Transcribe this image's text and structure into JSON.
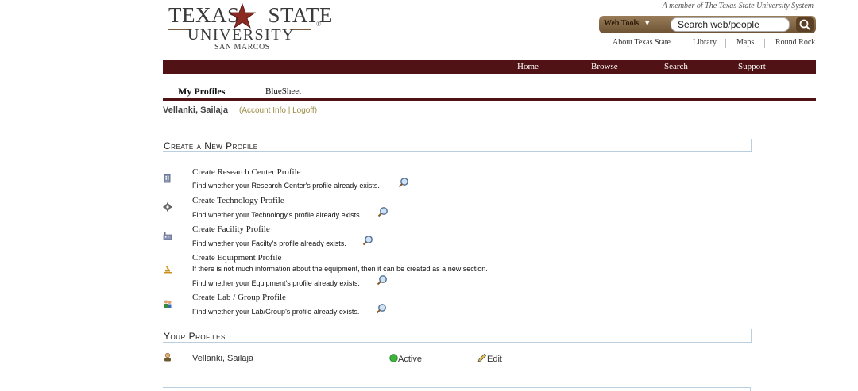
{
  "logo": {
    "line1_a": "TEXAS",
    "line1_b": "STATE",
    "line2": "UNIVERSITY",
    "line3": "SAN MARCOS",
    "reg": "®"
  },
  "member_text": "A member of The Texas State University System",
  "search": {
    "webtools_label": "Web Tools",
    "caret": "▼",
    "placeholder": "Search web/people",
    "value": "Search web/people"
  },
  "toplinks": [
    "About Texas State",
    "Library",
    "Maps",
    "Round Rock"
  ],
  "nav": [
    "Home",
    "Browse",
    "Search",
    "Support"
  ],
  "tabs": {
    "active": "My Profiles",
    "other": "BlueSheet"
  },
  "user": {
    "name": "Vellanki, Sailaja",
    "links": "(Account Info | Logoff)"
  },
  "create_section": {
    "title": "Create a New Profile",
    "items": [
      {
        "title": "Create Research Center Profile",
        "sub": "Find whether your Research Center's profile already exists.",
        "icon": "building-icon"
      },
      {
        "title": "Create Technology Profile",
        "sub": "Find whether your Technology's profile already exists.",
        "icon": "gear-icon"
      },
      {
        "title": "Create Facility Profile",
        "sub": "Find whether your Facilty's profile already exists.",
        "icon": "factory-icon"
      },
      {
        "title": "Create Equipment Profile",
        "note": "If there is not much information about the equipment, then it can be created as a new section.",
        "sub": "Find whether your Equipment's profile already exists.",
        "icon": "microscope-icon"
      },
      {
        "title": "Create Lab / Group Profile",
        "sub": "Find whether your Lab/Group's profile already exists.",
        "icon": "group-icon"
      }
    ]
  },
  "your_profiles": {
    "title": "Your Profiles",
    "rows": [
      {
        "name": "Vellanki, Sailaja",
        "status": "Active",
        "edit": "Edit"
      }
    ]
  },
  "colors": {
    "maroon": "#501214",
    "gold": "#9a8a45",
    "star": "#8b2a22",
    "section_border": "#b9cfe0"
  }
}
